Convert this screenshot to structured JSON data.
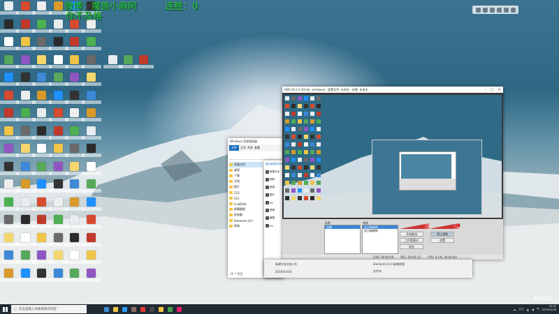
{
  "overlay": {
    "streamer_line": "微博：魔兽小麻阿",
    "streak_label": "连胜：",
    "streak_value": "0",
    "tagline": "你不及格"
  },
  "explorer": {
    "title": "Windows 资源管理器",
    "file_tab": "文件",
    "tabs": [
      "主页",
      "共享",
      "查看"
    ],
    "nav_items": [
      {
        "label": "快速访问",
        "selected": true
      },
      {
        "label": "桌面",
        "selected": false
      },
      {
        "label": "下载",
        "selected": false
      },
      {
        "label": "文档",
        "selected": false
      },
      {
        "label": "图片",
        "selected": false
      },
      {
        "label": "123",
        "selected": false
      },
      {
        "label": "521",
        "selected": false
      },
      {
        "label": "LiveData",
        "selected": false
      },
      {
        "label": "屏幕截图",
        "selected": false
      },
      {
        "label": "此电脑",
        "selected": false
      },
      {
        "label": "Elements (G:)",
        "selected": false
      },
      {
        "label": "网络",
        "selected": false
      }
    ],
    "status": "19 个项目"
  },
  "obs": {
    "title": "OBS 24.0.3 (64-bit, windows) - 配置文件: 未命名 - 场景: 未命名",
    "scenes_header": "场景",
    "sources_header": "来源",
    "scenes": [
      "场景"
    ],
    "sources": [
      {
        "label": "显示器捕获",
        "selected": true
      },
      {
        "label": "显示器捕获",
        "selected": false
      }
    ],
    "controls": [
      {
        "label": "开始推流",
        "on": false
      },
      {
        "label": "停止录制",
        "on": true
      },
      {
        "label": "工作室模式",
        "on": false
      },
      {
        "label": "设置",
        "on": false
      },
      {
        "label": "退出",
        "on": false
      }
    ],
    "status": {
      "live": "LIVE: 00:00:00",
      "rec": "REC: 00:05:12",
      "cpu": "CPU: 6.1%, 30.00 fps"
    }
  },
  "midlist": {
    "header": "最近使用的文件",
    "rows": [
      "新建文本",
      "视频",
      "新建",
      "图片",
      "mc",
      "录屏",
      "截图",
      "mc"
    ]
  },
  "lowerstrip": {
    "cells": [
      "新建文本文档 (4)",
      "Elements (G:)\\录制视频",
      "文件夹",
      "2019/10/18"
    ]
  },
  "taskbar": {
    "search_placeholder": "在这里输入你要搜索的内容",
    "tray_temp": "5°C",
    "tray_lang": "中",
    "time": "22:31",
    "date": "2019/12/16",
    "icons": [
      "ie-icon",
      "explorer-icon",
      "edge-icon",
      "store-icon",
      "game-icon",
      "obs-icon",
      "folder-icon",
      "app-icon",
      "app-icon-2"
    ]
  },
  "desktop_icon_colors": [
    "#e7ecef",
    "#f0c447",
    "#3d89d8",
    "#d64a2f",
    "#6a6a6a",
    "#56a85a",
    "#eeeeee",
    "#2b2b2b",
    "#9056c2",
    "#d99a2b",
    "#c0392b",
    "#f5d76e",
    "#1e90ff",
    "#4caf50",
    "#ffffff",
    "#333333"
  ],
  "watermark": "MIUI",
  "colors": {
    "overlay_green": "#28c83a",
    "taskbar": "#1f2a33",
    "accent": "#1a6fc2"
  }
}
